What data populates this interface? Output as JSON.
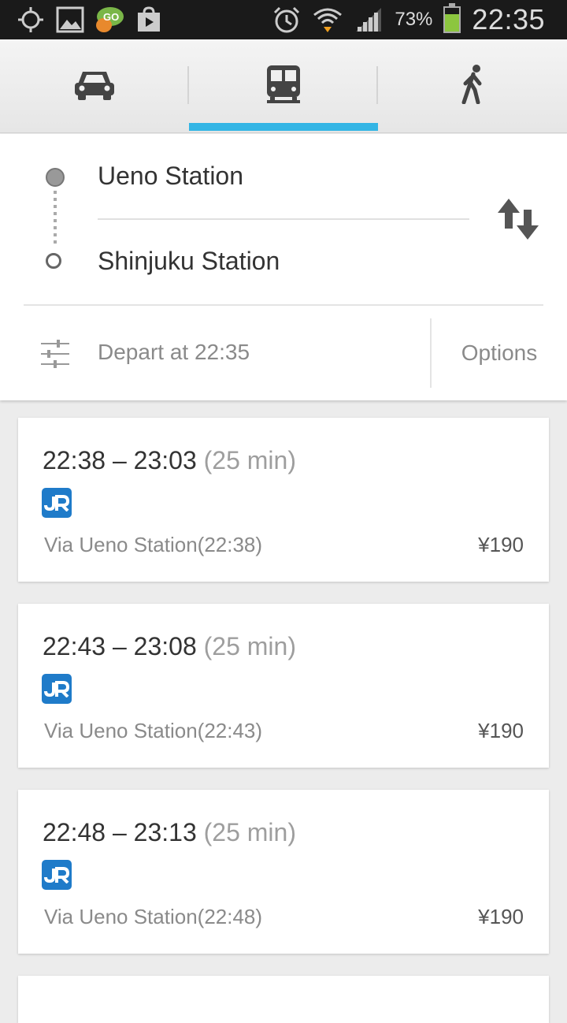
{
  "status_bar": {
    "battery_percent": "73%",
    "battery_level": 0.73,
    "time": "22:35",
    "left_icons": [
      "gps-icon",
      "gallery-icon",
      "go-sms-icon",
      "play-store-icon"
    ],
    "right_icons": [
      "alarm-icon",
      "wifi-icon",
      "signal-icon",
      "battery-icon"
    ],
    "colors": {
      "battery": "#8cc63f"
    }
  },
  "mode_tabs": [
    {
      "name": "drive",
      "icon": "car-icon",
      "selected": false
    },
    {
      "name": "transit",
      "icon": "train-icon",
      "selected": true
    },
    {
      "name": "walk",
      "icon": "walk-icon",
      "selected": false
    }
  ],
  "accent_color": "#33b5e5",
  "route": {
    "from": "Ueno Station",
    "to": "Shinjuku Station",
    "depart": "Depart at 22:35",
    "options_label": "Options"
  },
  "results": [
    {
      "times": "22:38 – 23:03",
      "duration": "(25 min)",
      "operator": "JR",
      "via": "Via Ueno Station(22:38)",
      "fare": "¥190"
    },
    {
      "times": "22:43 – 23:08",
      "duration": "(25 min)",
      "operator": "JR",
      "via": "Via Ueno Station(22:43)",
      "fare": "¥190"
    },
    {
      "times": "22:48 – 23:13",
      "duration": "(25 min)",
      "operator": "JR",
      "via": "Via Ueno Station(22:48)",
      "fare": "¥190"
    }
  ]
}
